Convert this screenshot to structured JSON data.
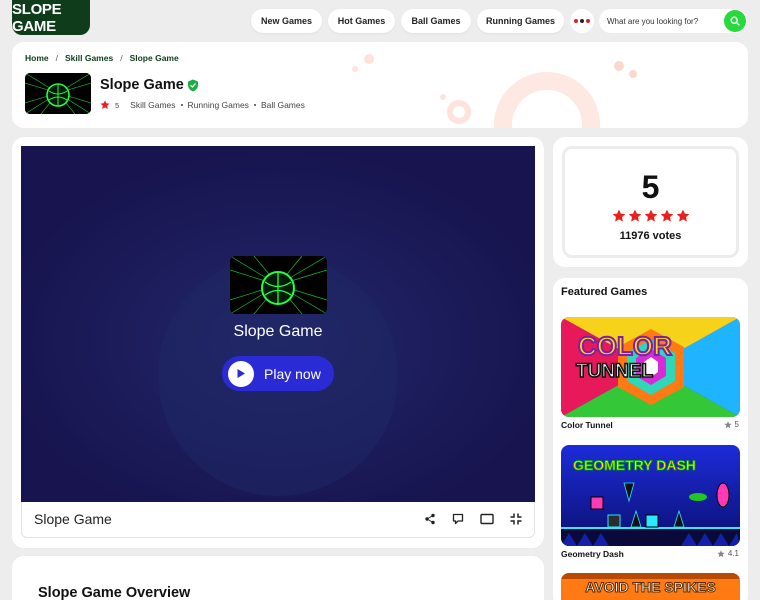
{
  "header": {
    "logo_text": "SLOPE GAME",
    "nav": [
      "New Games",
      "Hot Games",
      "Ball Games",
      "Running Games"
    ],
    "more_dot_colors": [
      "#e02020",
      "#222222",
      "#e02020"
    ],
    "search_placeholder": "What are you looking for?",
    "accent_color": "#27d93d"
  },
  "breadcrumb": [
    "Home",
    "Skill Games",
    "Slope Game"
  ],
  "game": {
    "title": "Slope Game",
    "rating": "5",
    "categories": [
      "Skill Games",
      "Running Games",
      "Ball Games"
    ],
    "play_label": "Play now"
  },
  "rating_box": {
    "value": "5",
    "stars": 5,
    "votes": "11976 votes",
    "star_color": "#e82020"
  },
  "overview": {
    "title": "Slope Game Overview"
  },
  "featured": {
    "heading": "Featured Games",
    "items": [
      {
        "name": "Color Tunnel",
        "rating": "5",
        "image_text_top": "COLOR",
        "image_text_bottom": "TUNNEL"
      },
      {
        "name": "Geometry Dash",
        "rating": "4.1",
        "image_text": "GEOMETRY DASH"
      },
      {
        "image_text": "AVOID THE SPIKES"
      }
    ]
  }
}
